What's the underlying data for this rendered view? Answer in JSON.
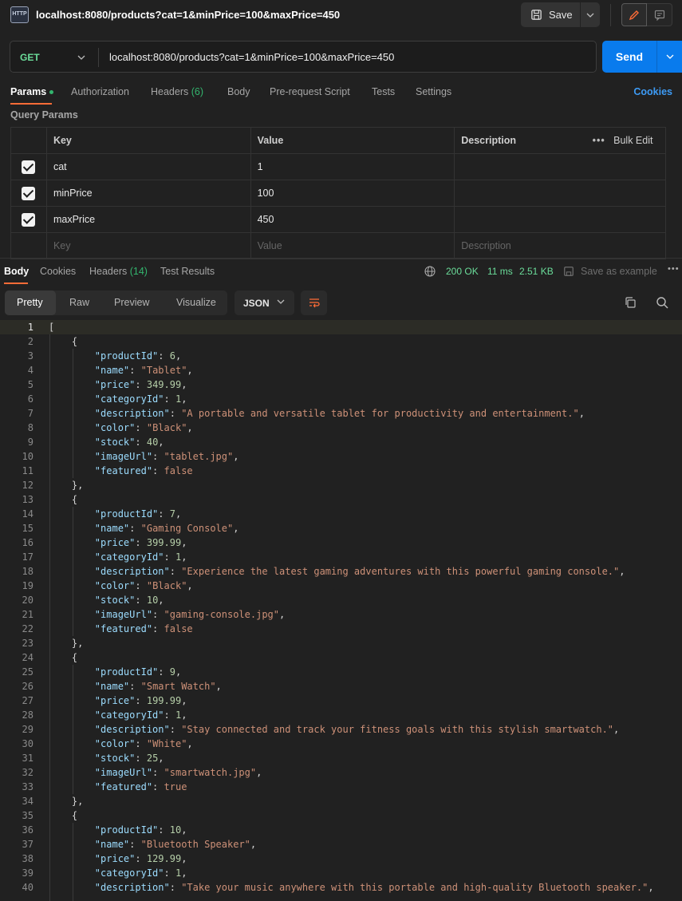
{
  "header": {
    "icon_label": "HTTP",
    "title": "localhost:8080/products?cat=1&minPrice=100&maxPrice=450",
    "save_label": "Save"
  },
  "request": {
    "method": "GET",
    "url": "localhost:8080/products?cat=1&minPrice=100&maxPrice=450",
    "send_label": "Send"
  },
  "req_tabs": {
    "params": "Params",
    "authorization": "Authorization",
    "headers": "Headers",
    "headers_count": "(6)",
    "body": "Body",
    "prerequest": "Pre-request Script",
    "tests": "Tests",
    "settings": "Settings",
    "cookies": "Cookies"
  },
  "query_params": {
    "title": "Query Params",
    "columns": {
      "key": "Key",
      "value": "Value",
      "description": "Description",
      "bulk_edit": "Bulk Edit"
    },
    "rows": [
      {
        "key": "cat",
        "value": "1",
        "description": ""
      },
      {
        "key": "minPrice",
        "value": "100",
        "description": ""
      },
      {
        "key": "maxPrice",
        "value": "450",
        "description": ""
      }
    ],
    "placeholder": {
      "key": "Key",
      "value": "Value",
      "description": "Description"
    }
  },
  "response": {
    "tabs": {
      "body": "Body",
      "cookies": "Cookies",
      "headers": "Headers",
      "headers_count": "(14)",
      "test_results": "Test Results"
    },
    "status": "200 OK",
    "time": "11 ms",
    "size": "2.51 KB",
    "save_example": "Save as example",
    "view_tabs": {
      "pretty": "Pretty",
      "raw": "Raw",
      "preview": "Preview",
      "visualize": "Visualize"
    },
    "format": "JSON"
  },
  "code_lines": [
    "[",
    "    {",
    "        \"productId\": 6,",
    "        \"name\": \"Tablet\",",
    "        \"price\": 349.99,",
    "        \"categoryId\": 1,",
    "        \"description\": \"A portable and versatile tablet for productivity and entertainment.\",",
    "        \"color\": \"Black\",",
    "        \"stock\": 40,",
    "        \"imageUrl\": \"tablet.jpg\",",
    "        \"featured\": false",
    "    },",
    "    {",
    "        \"productId\": 7,",
    "        \"name\": \"Gaming Console\",",
    "        \"price\": 399.99,",
    "        \"categoryId\": 1,",
    "        \"description\": \"Experience the latest gaming adventures with this powerful gaming console.\",",
    "        \"color\": \"Black\",",
    "        \"stock\": 10,",
    "        \"imageUrl\": \"gaming-console.jpg\",",
    "        \"featured\": false",
    "    },",
    "    {",
    "        \"productId\": 9,",
    "        \"name\": \"Smart Watch\",",
    "        \"price\": 199.99,",
    "        \"categoryId\": 1,",
    "        \"description\": \"Stay connected and track your fitness goals with this stylish smartwatch.\",",
    "        \"color\": \"White\",",
    "        \"stock\": 25,",
    "        \"imageUrl\": \"smartwatch.jpg\",",
    "        \"featured\": true",
    "    },",
    "    {",
    "        \"productId\": 10,",
    "        \"name\": \"Bluetooth Speaker\",",
    "        \"price\": 129.99,",
    "        \"categoryId\": 1,",
    "        \"description\": \"Take your music anywhere with this portable and high-quality Bluetooth speaker.\","
  ],
  "colors": {
    "accent_orange": "#ff6c37",
    "send_blue": "#097bed",
    "method_green": "#6bdd9a",
    "json_key": "#9cdcfe",
    "json_string": "#ce9178",
    "json_number": "#b5cea8"
  }
}
